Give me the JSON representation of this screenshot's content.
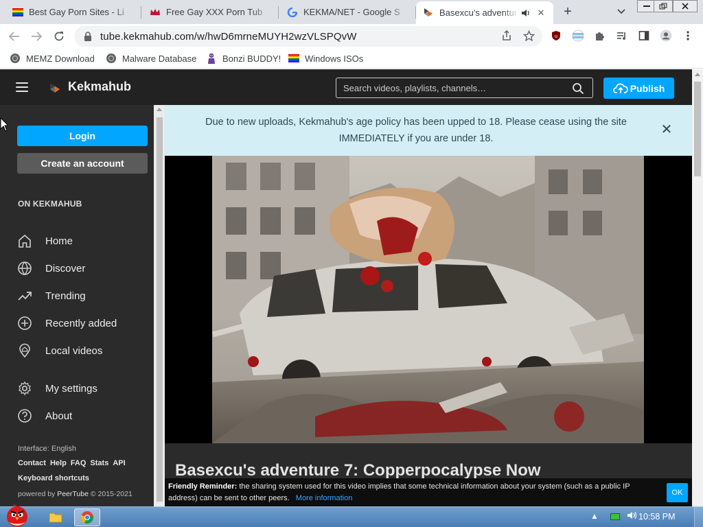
{
  "browser": {
    "tabs": [
      {
        "title": "Best Gay Porn Sites - Li",
        "favicon": "rainbow-flag-icon"
      },
      {
        "title": "Free Gay XXX Porn Tub",
        "favicon": "crown-icon"
      },
      {
        "title": "KEKMA/NET - Google S",
        "favicon": "google-icon"
      },
      {
        "title": "Basexcu's adventur",
        "favicon": "peertube-icon"
      }
    ],
    "url": "tube.kekmahub.com/w/hwD6mrneMUYH2wzVLSPQvW",
    "bookmarks": [
      {
        "label": "MEMZ Download"
      },
      {
        "label": "Malware Database"
      },
      {
        "label": "Bonzi BUDDY!"
      },
      {
        "label": "Windows ISOs"
      }
    ]
  },
  "header": {
    "brand": "Kekmahub",
    "search_placeholder": "Search videos, playlists, channels…",
    "publish_label": "Publish"
  },
  "sidebar": {
    "login_label": "Login",
    "create_label": "Create an account",
    "section_title": "ON KEKMAHUB",
    "items": [
      {
        "label": "Home",
        "icon": "home-icon"
      },
      {
        "label": "Discover",
        "icon": "globe-icon"
      },
      {
        "label": "Trending",
        "icon": "trending-icon"
      },
      {
        "label": "Recently added",
        "icon": "plus-circle-icon"
      },
      {
        "label": "Local videos",
        "icon": "location-icon"
      }
    ],
    "settings_items": [
      {
        "label": "My settings",
        "icon": "gear-icon"
      },
      {
        "label": "About",
        "icon": "help-icon"
      }
    ],
    "interface_label": "Interface: English",
    "links": [
      "Contact",
      "Help",
      "FAQ",
      "Stats",
      "API"
    ],
    "shortcuts_label": "Keyboard shortcuts",
    "powered_prefix": "powered by",
    "powered_name": "PeerTube",
    "powered_years": "© 2015-2021"
  },
  "notice": {
    "text": "Due to new uploads, Kekmahub's age policy has been upped to 18. Please cease using the site IMMEDIATELY if you are under 18."
  },
  "video": {
    "title": "Basexcu's adventure 7: Copperpocalypse Now"
  },
  "reminder": {
    "label": "Friendly Reminder:",
    "text": "the sharing system used for this video implies that some technical information about your system (such as a public IP address) can be sent to other peers.",
    "link": "More information",
    "ok_label": "OK"
  },
  "taskbar": {
    "time": "10:58 PM"
  },
  "colors": {
    "accent": "#00a6ff",
    "header_bg": "#222222",
    "sidebar_bg": "#2b2b2b",
    "notice_bg": "#d3eef5"
  }
}
